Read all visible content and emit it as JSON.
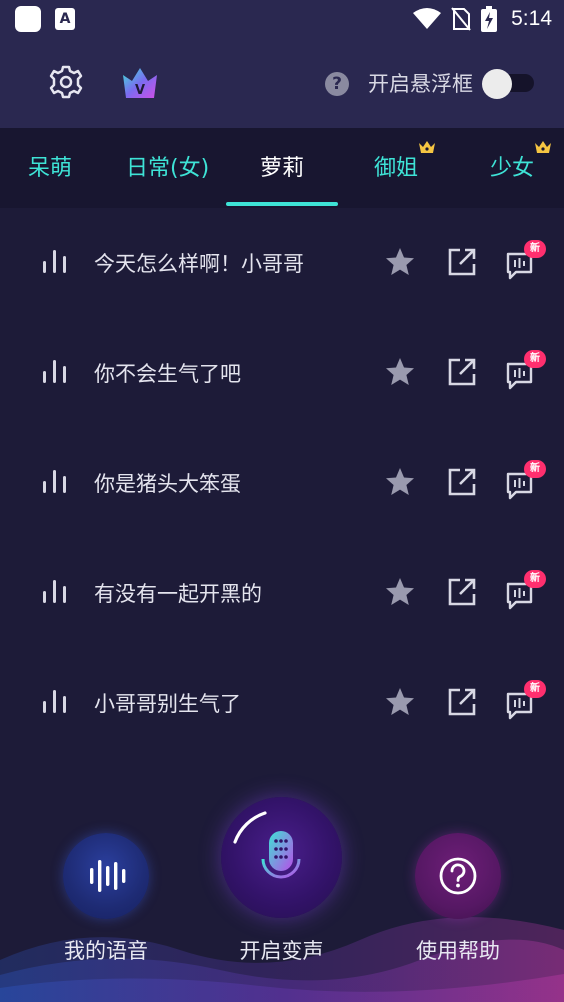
{
  "status_bar": {
    "time": "5:14",
    "notification_icons": [
      "app-square-icon",
      "a-text-icon"
    ],
    "system_icons": [
      "wifi-icon",
      "no-sim-icon",
      "battery-charging-icon"
    ]
  },
  "header": {
    "settings_icon": "gear-icon",
    "vip_icon": "vip-crown-icon",
    "help_icon": "question-icon",
    "floating_window_label": "开启悬浮框",
    "floating_window_enabled": false
  },
  "tabs": [
    {
      "label": "呆萌",
      "active": false,
      "premium": false
    },
    {
      "label": "日常(女)",
      "active": false,
      "premium": false
    },
    {
      "label": "萝莉",
      "active": true,
      "premium": false
    },
    {
      "label": "御姐",
      "active": false,
      "premium": true
    },
    {
      "label": "少女",
      "active": false,
      "premium": true
    }
  ],
  "phrases": [
    {
      "text": "今天怎么样啊！小哥哥",
      "badge": "新"
    },
    {
      "text": "你不会生气了吧",
      "badge": "新"
    },
    {
      "text": "你是猪头大笨蛋",
      "badge": "新"
    },
    {
      "text": "有没有一起开黑的",
      "badge": "新"
    },
    {
      "text": "小哥哥别生气了",
      "badge": "新"
    }
  ],
  "bottom_nav": {
    "my_voice_label": "我的语音",
    "start_voice_change_label": "开启变声",
    "help_label": "使用帮助"
  },
  "colors": {
    "background": "#1d1b38",
    "header": "#2a2850",
    "accent": "#3ee3d6",
    "badge": "#ff2f6e",
    "crown": "#f5c542"
  }
}
